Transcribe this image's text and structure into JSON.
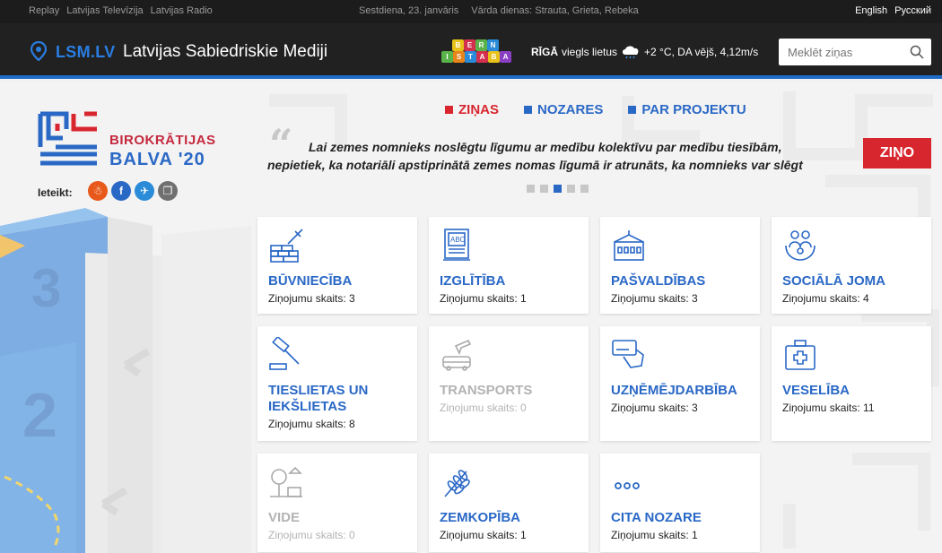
{
  "topbar": {
    "links": [
      "Replay",
      "Latvijas Televīzija",
      "Latvijas Radio"
    ],
    "date": "Sestdiena, 23. janvāris",
    "namedays": "Vārda dienas: Strauta, Grieta, Rebeka",
    "lang_en": "English",
    "lang_ru": "Русский"
  },
  "header": {
    "logo": "LSM.LV",
    "title": "Latvijas Sabiedriskie Mediji",
    "blocks_top": [
      "B",
      "E",
      "R",
      "N"
    ],
    "blocks_bottom": [
      "I",
      "S",
      "T",
      "A",
      "B",
      "A"
    ],
    "weather_city": "RĪGĀ",
    "weather_text": "viegls lietus",
    "weather_temp": "+2 °C, DA vējš, 4,12m/s",
    "search_placeholder": "Meklēt ziņas"
  },
  "award": {
    "line1": "BIROKRĀTIJAS",
    "line2": "BALVA '20"
  },
  "share": {
    "label": "Ieteikt:",
    "icons": [
      "draugiem-icon",
      "facebook-icon",
      "twitter-icon",
      "copy-icon"
    ]
  },
  "nav": {
    "items": [
      "ZIŅAS",
      "NOZARES",
      "PAR PROJEKTU"
    ]
  },
  "quote": {
    "line1": "Lai zemes nomnieks noslēgtu līgumu ar medību kolektīvu par medību tiesībām,",
    "line2": "nepietiek, ka notariāli apstiprinātā zemes nomas līgumā ir atrunāts, ka nomnieks var slēgt"
  },
  "zino_label": "ZIŅO",
  "cards": [
    {
      "title": "BŪVNIECĪBA",
      "count": "Ziņojumu skaits: 3",
      "icon": "construction-icon"
    },
    {
      "title": "IZGLĪTĪBA",
      "count": "Ziņojumu skaits: 1",
      "icon": "blackboard-icon"
    },
    {
      "title": "PAŠVALDĪBAS",
      "count": "Ziņojumu skaits: 3",
      "icon": "municipal-building-icon"
    },
    {
      "title": "SOCIĀLĀ JOMA",
      "count": "Ziņojumu skaits: 4",
      "icon": "people-care-icon"
    },
    {
      "title": "TIESLIETAS UN IEKŠLIETAS",
      "count": "Ziņojumu skaits: 8",
      "icon": "gavel-icon"
    },
    {
      "title": "TRANSPORTS",
      "count": "Ziņojumu skaits: 0",
      "icon": "transport-icon"
    },
    {
      "title": "UZŅĒMĒJDARBĪBA",
      "count": "Ziņojumu skaits: 3",
      "icon": "credit-card-icon"
    },
    {
      "title": "VESELĪBA",
      "count": "Ziņojumu skaits: 11",
      "icon": "medical-kit-icon"
    },
    {
      "title": "VIDE",
      "count": "Ziņojumu skaits: 0",
      "icon": "environment-icon"
    },
    {
      "title": "ZEMKOPĪBA",
      "count": "Ziņojumu skaits: 1",
      "icon": "wheat-icon"
    },
    {
      "title": "CITA NOZARE",
      "count": "Ziņojumu skaits: 1",
      "icon": "more-icon"
    }
  ],
  "colors": {
    "brand_blue": "#2a68c6",
    "brand_red": "#d8262f"
  }
}
